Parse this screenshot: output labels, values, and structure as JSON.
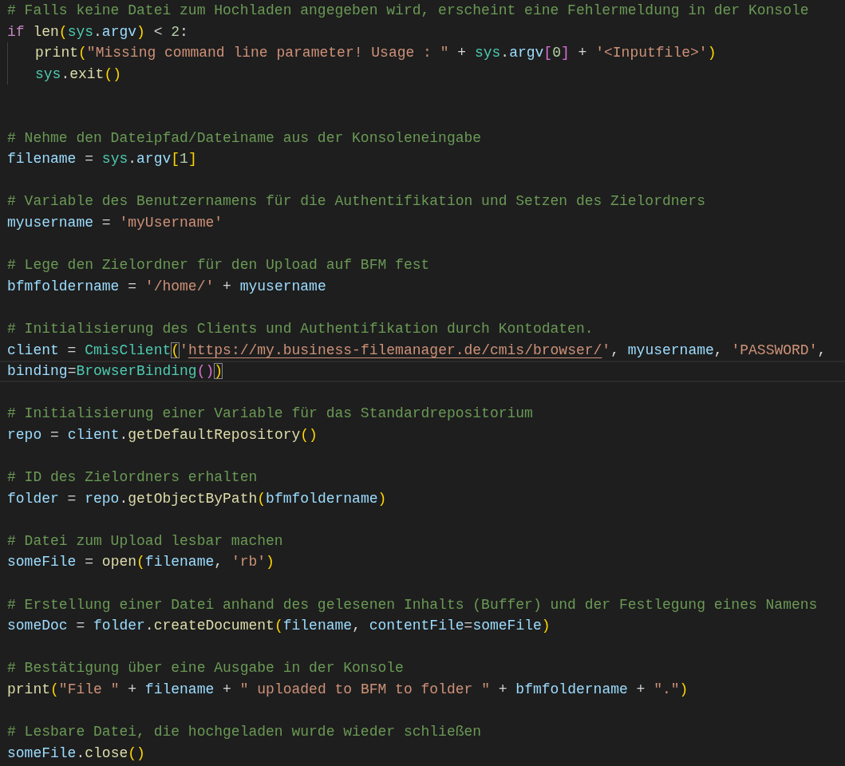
{
  "editor": {
    "lines": [
      {
        "current": false,
        "tokens": [
          {
            "text": "# Falls keine Datei zum Hochladen angegeben wird, erscheint eine Fehlermeldung in der Konsole",
            "kind": "comment"
          }
        ]
      },
      {
        "current": false,
        "tokens": [
          {
            "text": "if ",
            "kind": "keyword"
          },
          {
            "text": "len",
            "kind": "function"
          },
          {
            "text": "(",
            "kind": "bracket"
          },
          {
            "text": "sys",
            "kind": "module"
          },
          {
            "text": ".",
            "kind": "op"
          },
          {
            "text": "argv",
            "kind": "variable"
          },
          {
            "text": ")",
            "kind": "bracket"
          },
          {
            "text": " < ",
            "kind": "op"
          },
          {
            "text": "2",
            "kind": "number"
          },
          {
            "text": ":",
            "kind": "op"
          }
        ],
        "children": [
          {
            "current": false,
            "tokens": [
              {
                "text": "print",
                "kind": "function"
              },
              {
                "text": "(",
                "kind": "bracket"
              },
              {
                "text": "\"Missing command line parameter! Usage : \"",
                "kind": "string"
              },
              {
                "text": " + ",
                "kind": "op"
              },
              {
                "text": "sys",
                "kind": "module"
              },
              {
                "text": ".",
                "kind": "op"
              },
              {
                "text": "argv",
                "kind": "variable"
              },
              {
                "text": "[",
                "kind": "bracket2"
              },
              {
                "text": "0",
                "kind": "number"
              },
              {
                "text": "]",
                "kind": "bracket2"
              },
              {
                "text": " + ",
                "kind": "op"
              },
              {
                "text": "'<Inputfile>'",
                "kind": "string"
              },
              {
                "text": ")",
                "kind": "bracket"
              }
            ]
          },
          {
            "current": false,
            "tokens": [
              {
                "text": "sys",
                "kind": "module"
              },
              {
                "text": ".",
                "kind": "op"
              },
              {
                "text": "exit",
                "kind": "function"
              },
              {
                "text": "()",
                "kind": "bracket"
              }
            ]
          }
        ]
      },
      {
        "current": false
      },
      {
        "current": false
      },
      {
        "current": false,
        "tokens": [
          {
            "text": "# Nehme den Dateipfad/Dateiname aus der Konsoleneingabe",
            "kind": "comment"
          }
        ]
      },
      {
        "current": false,
        "tokens": [
          {
            "text": "filename",
            "kind": "variable"
          },
          {
            "text": " = ",
            "kind": "op"
          },
          {
            "text": "sys",
            "kind": "module"
          },
          {
            "text": ".",
            "kind": "op"
          },
          {
            "text": "argv",
            "kind": "variable"
          },
          {
            "text": "[",
            "kind": "bracket"
          },
          {
            "text": "1",
            "kind": "number"
          },
          {
            "text": "]",
            "kind": "bracket"
          }
        ]
      },
      {
        "current": false
      },
      {
        "current": false,
        "tokens": [
          {
            "text": "# Variable des Benutzernamens für die Authentifikation und Setzen des Zielordners",
            "kind": "comment"
          }
        ]
      },
      {
        "current": false,
        "tokens": [
          {
            "text": "myusername",
            "kind": "variable"
          },
          {
            "text": " = ",
            "kind": "op"
          },
          {
            "text": "'myUsername'",
            "kind": "string"
          }
        ]
      },
      {
        "current": false
      },
      {
        "current": false,
        "tokens": [
          {
            "text": "# Lege den Zielordner für den Upload auf BFM fest",
            "kind": "comment"
          }
        ]
      },
      {
        "current": false,
        "tokens": [
          {
            "text": "bfmfoldername",
            "kind": "variable"
          },
          {
            "text": " = ",
            "kind": "op"
          },
          {
            "text": "'/home/'",
            "kind": "string"
          },
          {
            "text": " + ",
            "kind": "op"
          },
          {
            "text": "myusername",
            "kind": "variable"
          }
        ]
      },
      {
        "current": false
      },
      {
        "current": false,
        "tokens": [
          {
            "text": "# Initialisierung des Clients und Authentifikation durch Kontodaten.",
            "kind": "comment"
          }
        ]
      },
      {
        "current": false,
        "tokens": [
          {
            "text": "client",
            "kind": "variable"
          },
          {
            "text": " = ",
            "kind": "op"
          },
          {
            "text": "CmisClient",
            "kind": "class"
          },
          {
            "text": "(",
            "kind": "bracket-match"
          },
          {
            "text": "'",
            "kind": "string"
          },
          {
            "text": "https://my.business-filemanager.de/cmis/browser/",
            "kind": "link"
          },
          {
            "text": "'",
            "kind": "string"
          },
          {
            "text": ", ",
            "kind": "op"
          },
          {
            "text": "myusername",
            "kind": "variable"
          },
          {
            "text": ", ",
            "kind": "op"
          },
          {
            "text": "'PASSWORD'",
            "kind": "string"
          },
          {
            "text": ",",
            "kind": "op"
          }
        ]
      },
      {
        "current": true,
        "tokens": [
          {
            "text": "binding",
            "kind": "variable"
          },
          {
            "text": "=",
            "kind": "op"
          },
          {
            "text": "BrowserBinding",
            "kind": "class"
          },
          {
            "text": "()",
            "kind": "bracket2"
          },
          {
            "text": ")",
            "kind": "bracket-match"
          }
        ]
      },
      {
        "current": false
      },
      {
        "current": false,
        "tokens": [
          {
            "text": "# Initialisierung einer Variable für das Standardrepositorium",
            "kind": "comment"
          }
        ]
      },
      {
        "current": false,
        "tokens": [
          {
            "text": "repo",
            "kind": "variable"
          },
          {
            "text": " = ",
            "kind": "op"
          },
          {
            "text": "client",
            "kind": "variable"
          },
          {
            "text": ".",
            "kind": "op"
          },
          {
            "text": "getDefaultRepository",
            "kind": "function"
          },
          {
            "text": "()",
            "kind": "bracket"
          }
        ]
      },
      {
        "current": false
      },
      {
        "current": false,
        "tokens": [
          {
            "text": "# ID des Zielordners erhalten",
            "kind": "comment"
          }
        ]
      },
      {
        "current": false,
        "tokens": [
          {
            "text": "folder",
            "kind": "variable"
          },
          {
            "text": " = ",
            "kind": "op"
          },
          {
            "text": "repo",
            "kind": "variable"
          },
          {
            "text": ".",
            "kind": "op"
          },
          {
            "text": "getObjectByPath",
            "kind": "function"
          },
          {
            "text": "(",
            "kind": "bracket"
          },
          {
            "text": "bfmfoldername",
            "kind": "variable"
          },
          {
            "text": ")",
            "kind": "bracket"
          }
        ]
      },
      {
        "current": false
      },
      {
        "current": false,
        "tokens": [
          {
            "text": "# Datei zum Upload lesbar machen",
            "kind": "comment"
          }
        ]
      },
      {
        "current": false,
        "tokens": [
          {
            "text": "someFile",
            "kind": "variable"
          },
          {
            "text": " = ",
            "kind": "op"
          },
          {
            "text": "open",
            "kind": "function"
          },
          {
            "text": "(",
            "kind": "bracket"
          },
          {
            "text": "filename",
            "kind": "variable"
          },
          {
            "text": ", ",
            "kind": "op"
          },
          {
            "text": "'rb'",
            "kind": "string"
          },
          {
            "text": ")",
            "kind": "bracket"
          }
        ]
      },
      {
        "current": false
      },
      {
        "current": false,
        "tokens": [
          {
            "text": "# Erstellung einer Datei anhand des gelesenen Inhalts (Buffer) und der Festlegung eines Namens",
            "kind": "comment"
          }
        ]
      },
      {
        "current": false,
        "tokens": [
          {
            "text": "someDoc",
            "kind": "variable"
          },
          {
            "text": " = ",
            "kind": "op"
          },
          {
            "text": "folder",
            "kind": "variable"
          },
          {
            "text": ".",
            "kind": "op"
          },
          {
            "text": "createDocument",
            "kind": "function"
          },
          {
            "text": "(",
            "kind": "bracket"
          },
          {
            "text": "filename",
            "kind": "variable"
          },
          {
            "text": ", ",
            "kind": "op"
          },
          {
            "text": "contentFile",
            "kind": "variable"
          },
          {
            "text": "=",
            "kind": "op"
          },
          {
            "text": "someFile",
            "kind": "variable"
          },
          {
            "text": ")",
            "kind": "bracket"
          }
        ]
      },
      {
        "current": false
      },
      {
        "current": false,
        "tokens": [
          {
            "text": "# Bestätigung über eine Ausgabe in der Konsole",
            "kind": "comment"
          }
        ]
      },
      {
        "current": false,
        "tokens": [
          {
            "text": "print",
            "kind": "function"
          },
          {
            "text": "(",
            "kind": "bracket"
          },
          {
            "text": "\"File \"",
            "kind": "string"
          },
          {
            "text": " + ",
            "kind": "op"
          },
          {
            "text": "filename",
            "kind": "variable"
          },
          {
            "text": " + ",
            "kind": "op"
          },
          {
            "text": "\" uploaded to BFM to folder \"",
            "kind": "string"
          },
          {
            "text": " + ",
            "kind": "op"
          },
          {
            "text": "bfmfoldername",
            "kind": "variable"
          },
          {
            "text": " + ",
            "kind": "op"
          },
          {
            "text": "\".\"",
            "kind": "string"
          },
          {
            "text": ")",
            "kind": "bracket"
          }
        ]
      },
      {
        "current": false
      },
      {
        "current": false,
        "tokens": [
          {
            "text": "# Lesbare Datei, die hochgeladen wurde wieder schließen",
            "kind": "comment"
          }
        ]
      },
      {
        "current": false,
        "tokens": [
          {
            "text": "someFile",
            "kind": "variable"
          },
          {
            "text": ".",
            "kind": "op"
          },
          {
            "text": "close",
            "kind": "function"
          },
          {
            "text": "()",
            "kind": "bracket"
          }
        ]
      }
    ]
  }
}
